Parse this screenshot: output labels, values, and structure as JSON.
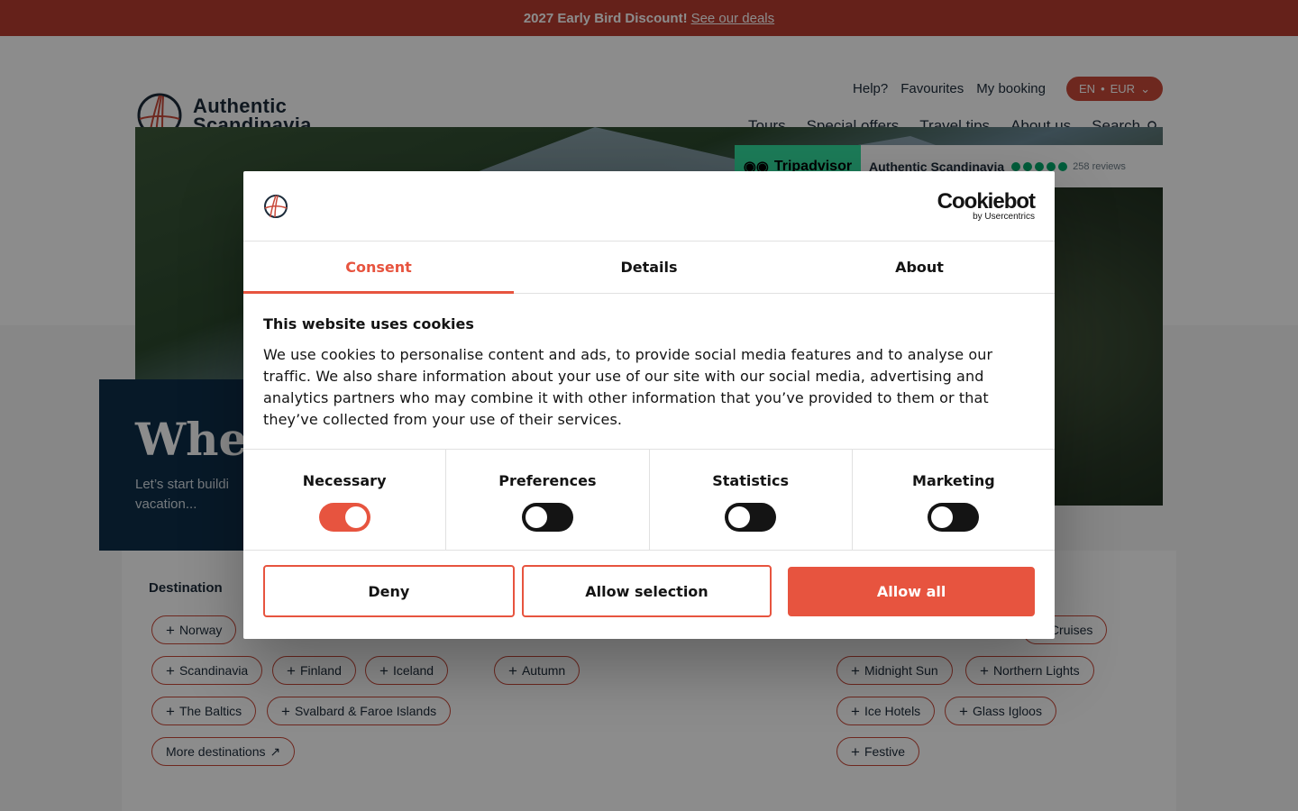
{
  "banner": {
    "strong": "2027 Early Bird Discount!",
    "link": "See our deals"
  },
  "header": {
    "logo_line1": "Authentic",
    "logo_line2": "Scandinavia",
    "util_nav": [
      "Help?",
      "Favourites",
      "My booking"
    ],
    "lang": "EN",
    "currency": "EUR",
    "main_nav": [
      "Tours",
      "Special offers",
      "Travel tips",
      "About us"
    ],
    "search": "Search"
  },
  "tripadvisor": {
    "brand": "Tripadvisor",
    "company": "Authentic Scandinavia",
    "rating_bubbles": 5,
    "reviews": "258 reviews"
  },
  "hero": {
    "title": "Wher",
    "subtitle": "Let’s start buildi",
    "subtitle2": "vacation..."
  },
  "filters": {
    "destination_title": "Destination",
    "destination_chips": [
      "Norway",
      "Scandinavia",
      "Finland",
      "Iceland",
      "The Baltics",
      "Svalbard & Faroe Islands"
    ],
    "more_destinations": "More destinations",
    "season_chips": [
      "Autumn"
    ],
    "theme_chips": [
      "Cruises",
      "Midnight Sun",
      "Northern Lights",
      "Ice Hotels",
      "Glass Igloos",
      "Festive"
    ]
  },
  "cookie_dialog": {
    "brand": "Cookiebot",
    "brand_sub": "by Usercentrics",
    "tabs": [
      "Consent",
      "Details",
      "About"
    ],
    "active_tab": "Consent",
    "title": "This website uses cookies",
    "body": "We use cookies to personalise content and ads, to provide social media features and to analyse our traffic. We also share information about your use of our site with our social media, advertising and analytics partners who may combine it with other information that you’ve provided to them or that they’ve collected from your use of their services.",
    "toggles": [
      {
        "label": "Necessary",
        "on": true
      },
      {
        "label": "Preferences",
        "on": false
      },
      {
        "label": "Statistics",
        "on": false
      },
      {
        "label": "Marketing",
        "on": false
      }
    ],
    "buttons": {
      "deny": "Deny",
      "selection": "Allow selection",
      "all": "Allow all"
    },
    "accent": "#e7543f"
  }
}
